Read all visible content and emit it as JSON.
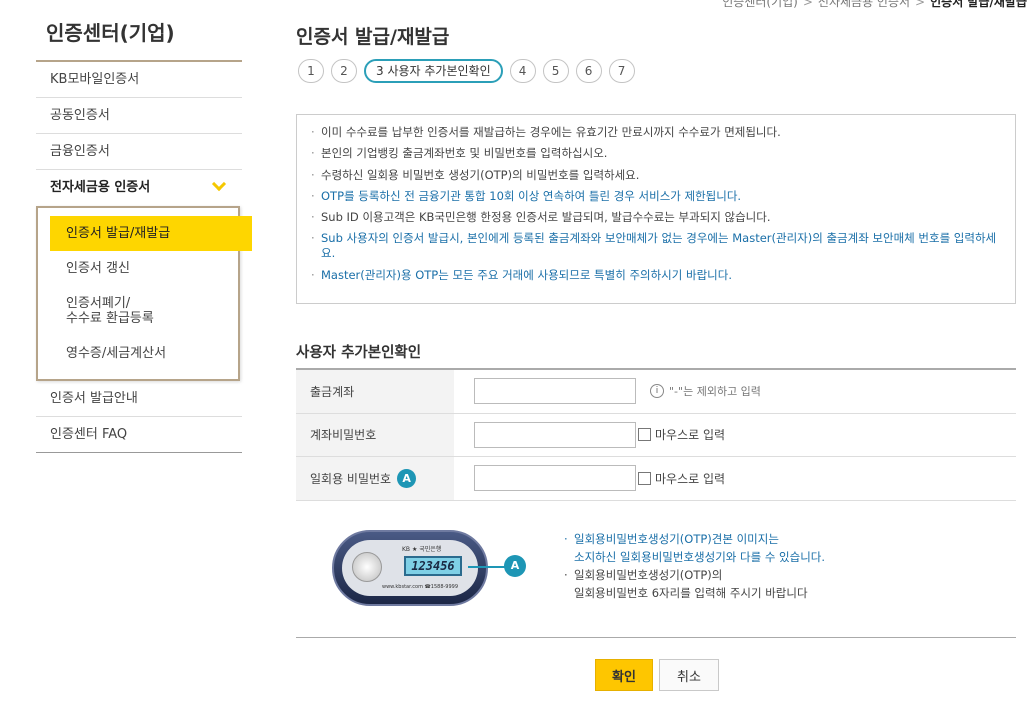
{
  "breadcrumb": [
    "인증센터(기업)",
    "전자세금용 인증서",
    "인증서 발급/재발급"
  ],
  "sidebar": {
    "title": "인증센터(기업)",
    "items": [
      {
        "label": "KB모바일인증서"
      },
      {
        "label": "공동인증서"
      },
      {
        "label": "금융인증서"
      },
      {
        "label": "전자세금용 인증서"
      }
    ],
    "sub_items": [
      {
        "label": "인증서 발급/재발급"
      },
      {
        "label": "인증서 갱신"
      },
      {
        "label_line1": "인증서폐기/",
        "label_line2": "수수료 환급등록"
      },
      {
        "label": "영수증/세금계산서"
      }
    ],
    "bottom_items": [
      {
        "label": "인증서 발급안내"
      },
      {
        "label": "인증센터 FAQ"
      }
    ]
  },
  "page": {
    "title": "인증서 발급/재발급",
    "steps": [
      "1",
      "2",
      "3 사용자 추가본인확인",
      "4",
      "5",
      "6",
      "7"
    ]
  },
  "notice": [
    {
      "text": "이미 수수료를 납부한 인증서를 재발급하는 경우에는 유효기간 만료시까지 수수료가 면제됩니다.",
      "blue": false
    },
    {
      "text": "본인의 기업뱅킹 출금계좌번호 및 비밀번호를 입력하십시오.",
      "blue": false
    },
    {
      "text": "수령하신 일회용 비밀번호 생성기(OTP)의 비밀번호를 입력하세요.",
      "blue": false
    },
    {
      "text": "OTP를 등록하신 전 금융기관 통합 10회 이상 연속하여 틀린 경우 서비스가 제한됩니다.",
      "blue": true
    },
    {
      "text": "Sub ID 이용고객은 KB국민은행 한정용 인증서로 발급되며, 발급수수료는 부과되지 않습니다.",
      "blue": false
    },
    {
      "text": "Sub 사용자의 인증서 발급시, 본인에게 등록된 출금계좌와 보안매체가 없는 경우에는 Master(관리자)의 출금계좌 보안매체 번호를 입력하세요.",
      "blue": true
    },
    {
      "text": "Master(관리자)용 OTP는 모든 주요 거래에 사용되므로 특별히 주의하시기 바랍니다.",
      "blue": true
    }
  ],
  "form": {
    "section_title": "사용자 추가본인확인",
    "account_label": "출금계좌",
    "account_hint": "\"-\"는 제외하고 입력",
    "info_icon": "i",
    "password_label": "계좌비밀번호",
    "password_mouse": "마우스로 입력",
    "otp_label": "일회용 비밀번호",
    "otp_badge": "A",
    "otp_mouse": "마우스로 입력"
  },
  "otp_device": {
    "logo": "KB ★ 국민은행",
    "screen": "123456",
    "url": "www.kbstar.com ☎1588-9999",
    "callout": "A"
  },
  "otp_notes": {
    "line1": "일회용비밀번호생성기(OTP)견본 이미지는",
    "line2": "소지하신 일회용비밀번호생성기와 다를 수 있습니다.",
    "line3": "일회용비밀번호생성기(OTP)의",
    "line4": "일회용비밀번호 6자리를 입력해 주시기 바랍니다"
  },
  "buttons": {
    "confirm": "확인",
    "cancel": "취소"
  }
}
